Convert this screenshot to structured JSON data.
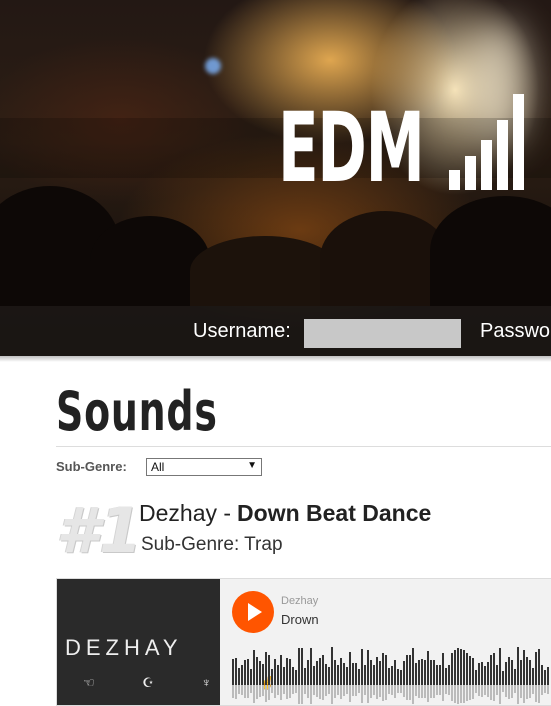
{
  "header": {
    "logo_text": "EDM",
    "login": {
      "username_label": "Username:",
      "username_value": "",
      "password_label": "Passwo"
    }
  },
  "sounds": {
    "title": "Sounds",
    "filter": {
      "label": "Sub-Genre:",
      "selected": "All"
    },
    "tracks": [
      {
        "rank": "#1",
        "artist": "Dezhay -",
        "title": "Down Beat Dance",
        "subgenre": "Sub-Genre: Trap",
        "player": {
          "artwork_text": "DEZHAY",
          "artwork_symbols": "☜ ☪ ♆ ✌",
          "artist": "Dezhay",
          "track": "Drown"
        }
      }
    ]
  },
  "colors": {
    "accent_play": "#ff5500",
    "waveform": "#333333"
  }
}
